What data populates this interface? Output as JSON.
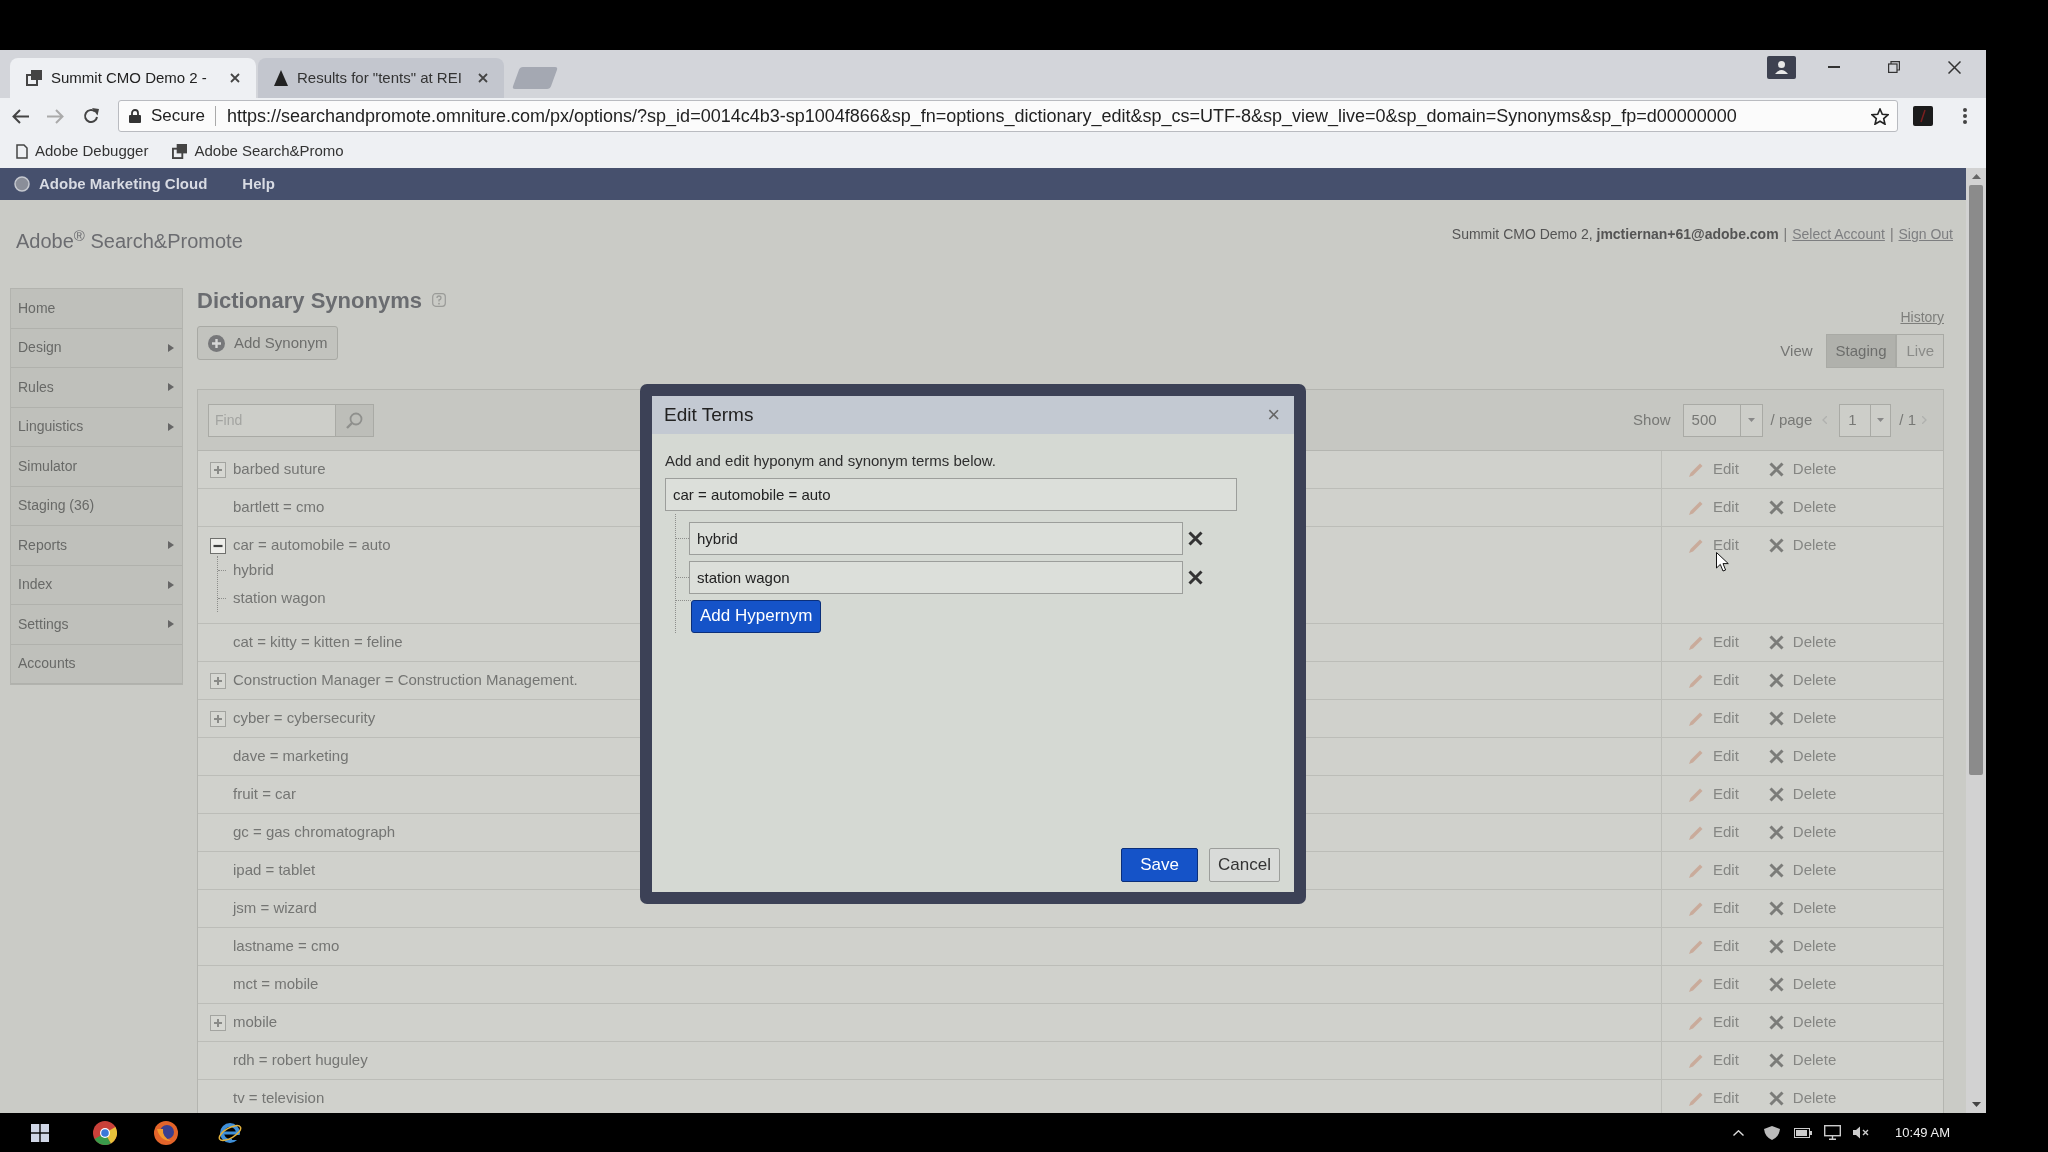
{
  "browser": {
    "tabs": [
      {
        "title": "Summit CMO Demo 2 -",
        "selected": true
      },
      {
        "title": "Results for \"tents\" at REI",
        "selected": false
      }
    ],
    "address": {
      "security": "Secure",
      "url": "https://searchandpromote.omniture.com/px/options/?sp_id=0014c4b3-sp1004f866&sp_fn=options_dictionary_edit&sp_cs=UTF-8&sp_view_live=0&sp_domain=Synonyms&sp_fp=d00000000"
    },
    "bookmarks": [
      {
        "label": "Adobe Debugger",
        "kind": "page"
      },
      {
        "label": "Adobe Search&Promo",
        "kind": "app"
      }
    ]
  },
  "top_nav": {
    "brand": "Adobe Marketing Cloud",
    "items": [
      "Help"
    ]
  },
  "header": {
    "logo": "Adobe$^{®}$ Search&Promote",
    "account": [
      {
        "kind": "text",
        "text": "Summit CMO Demo 2, **jmctiernan+61@adobe.com**"
      },
      {
        "kind": "separator",
        "text": "|"
      },
      {
        "kind": "link",
        "text": "Select Account"
      },
      {
        "kind": "separator",
        "text": "|"
      },
      {
        "kind": "link",
        "text": "Sign Out"
      }
    ]
  },
  "sidebar": {
    "items": [
      {
        "label": "Home",
        "submenu": false
      },
      {
        "label": "Design",
        "submenu": true
      },
      {
        "label": "Rules",
        "submenu": true
      },
      {
        "label": "Linguistics",
        "submenu": true
      },
      {
        "label": "Simulator",
        "submenu": false
      },
      {
        "label": "Staging (36)",
        "submenu": false
      },
      {
        "label": "Reports",
        "submenu": true
      },
      {
        "label": "Index",
        "submenu": true
      },
      {
        "label": "Settings",
        "submenu": true
      },
      {
        "label": "Accounts",
        "submenu": false
      }
    ]
  },
  "content": {
    "title": "Dictionary Synonyms",
    "add_button": "Add Synonym",
    "history_link": "History",
    "view": {
      "label": "View",
      "options": [
        {
          "label": "Staging",
          "selected": true
        },
        {
          "label": "Live",
          "selected": false
        }
      ]
    },
    "toolbar": {
      "find": {
        "placeholder": "Find"
      },
      "show_label": "Show",
      "page_size": "500",
      "per_page": "/ page",
      "page": "1",
      "page_total": "/ 1"
    },
    "rows": [
      {
        "term": "barbed suture",
        "kind": "group",
        "expanded": false,
        "actions": [
          "Edit",
          "Delete"
        ]
      },
      {
        "term": "bartlett = cmo",
        "kind": "pair",
        "actions": [
          "Edit",
          "Delete"
        ]
      },
      {
        "term": "car = automobile = auto",
        "kind": "group",
        "expanded": true,
        "children": [
          {
            "term": "hybrid"
          },
          {
            "term": "station wagon"
          }
        ],
        "actions": [
          "Edit",
          "Delete"
        ]
      },
      {
        "term": "cat = kitty = kitten = feline",
        "kind": "pair",
        "actions": [
          "Edit",
          "Delete"
        ]
      },
      {
        "term": "Construction Manager = Construction Management.",
        "kind": "group",
        "expanded": false,
        "actions": [
          "Edit",
          "Delete"
        ]
      },
      {
        "term": "cyber = cybersecurity",
        "kind": "group",
        "expanded": false,
        "actions": [
          "Edit",
          "Delete"
        ]
      },
      {
        "term": "dave = marketing",
        "kind": "pair",
        "actions": [
          "Edit",
          "Delete"
        ]
      },
      {
        "term": "fruit = car",
        "kind": "pair",
        "actions": [
          "Edit",
          "Delete"
        ]
      },
      {
        "term": "gc = gas chromatograph",
        "kind": "pair",
        "actions": [
          "Edit",
          "Delete"
        ]
      },
      {
        "term": "ipad = tablet",
        "kind": "pair",
        "actions": [
          "Edit",
          "Delete"
        ]
      },
      {
        "term": "jsm = wizard",
        "kind": "pair",
        "actions": [
          "Edit",
          "Delete"
        ]
      },
      {
        "term": "lastname = cmo",
        "kind": "pair",
        "actions": [
          "Edit",
          "Delete"
        ]
      },
      {
        "term": "mct = mobile",
        "kind": "pair",
        "actions": [
          "Edit",
          "Delete"
        ]
      },
      {
        "term": "mobile",
        "kind": "group",
        "expanded": false,
        "actions": [
          "Edit",
          "Delete"
        ]
      },
      {
        "term": "rdh = robert huguley",
        "kind": "pair",
        "actions": [
          "Edit",
          "Delete"
        ]
      },
      {
        "term": "tv = television",
        "kind": "pair",
        "actions": [
          "Edit",
          "Delete"
        ]
      }
    ]
  },
  "modal": {
    "title": "Edit Terms",
    "close": "×",
    "description": "Add and edit hyponym and synonym terms below.",
    "value": "car = automobile = auto",
    "hyponyms": [
      {
        "value": "hybrid"
      },
      {
        "value": "station wagon"
      }
    ],
    "add_button": "Add Hypernym",
    "buttons": [
      {
        "label": "Save",
        "kind": "primary"
      },
      {
        "label": "Cancel",
        "kind": "secondary"
      }
    ]
  },
  "taskbar": {
    "time": "10:49 AM"
  }
}
